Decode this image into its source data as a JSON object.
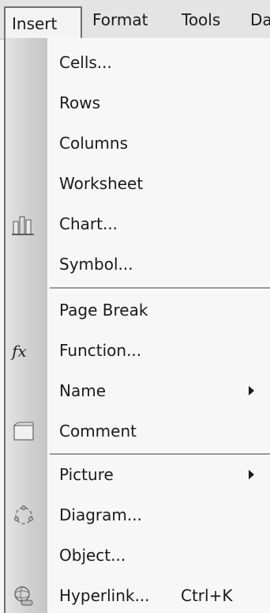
{
  "menubar": {
    "items": [
      {
        "label": "Insert",
        "active": true
      },
      {
        "label": "Format"
      },
      {
        "label": "Tools"
      },
      {
        "label": "Da"
      }
    ]
  },
  "menu": {
    "items": [
      {
        "label": "Cells..."
      },
      {
        "label": "Rows"
      },
      {
        "label": "Columns"
      },
      {
        "label": "Worksheet"
      },
      {
        "label": "Chart...",
        "icon": "chart-icon"
      },
      {
        "label": "Symbol..."
      },
      {
        "label": "Page Break"
      },
      {
        "label": "Function...",
        "icon": "function-fx-icon",
        "icon_text": "fx"
      },
      {
        "label": "Name",
        "submenu": true
      },
      {
        "label": "Comment",
        "icon": "comment-icon"
      },
      {
        "label": "Picture",
        "submenu": true
      },
      {
        "label": "Diagram...",
        "icon": "diagram-icon"
      },
      {
        "label": "Object..."
      },
      {
        "label": "Hyperlink...",
        "icon": "hyperlink-icon",
        "shortcut": "Ctrl+K"
      }
    ]
  },
  "colors": {
    "menu_background": "#f7f7f7",
    "icon_strip": "#cfcfcf",
    "border": "#707070"
  }
}
